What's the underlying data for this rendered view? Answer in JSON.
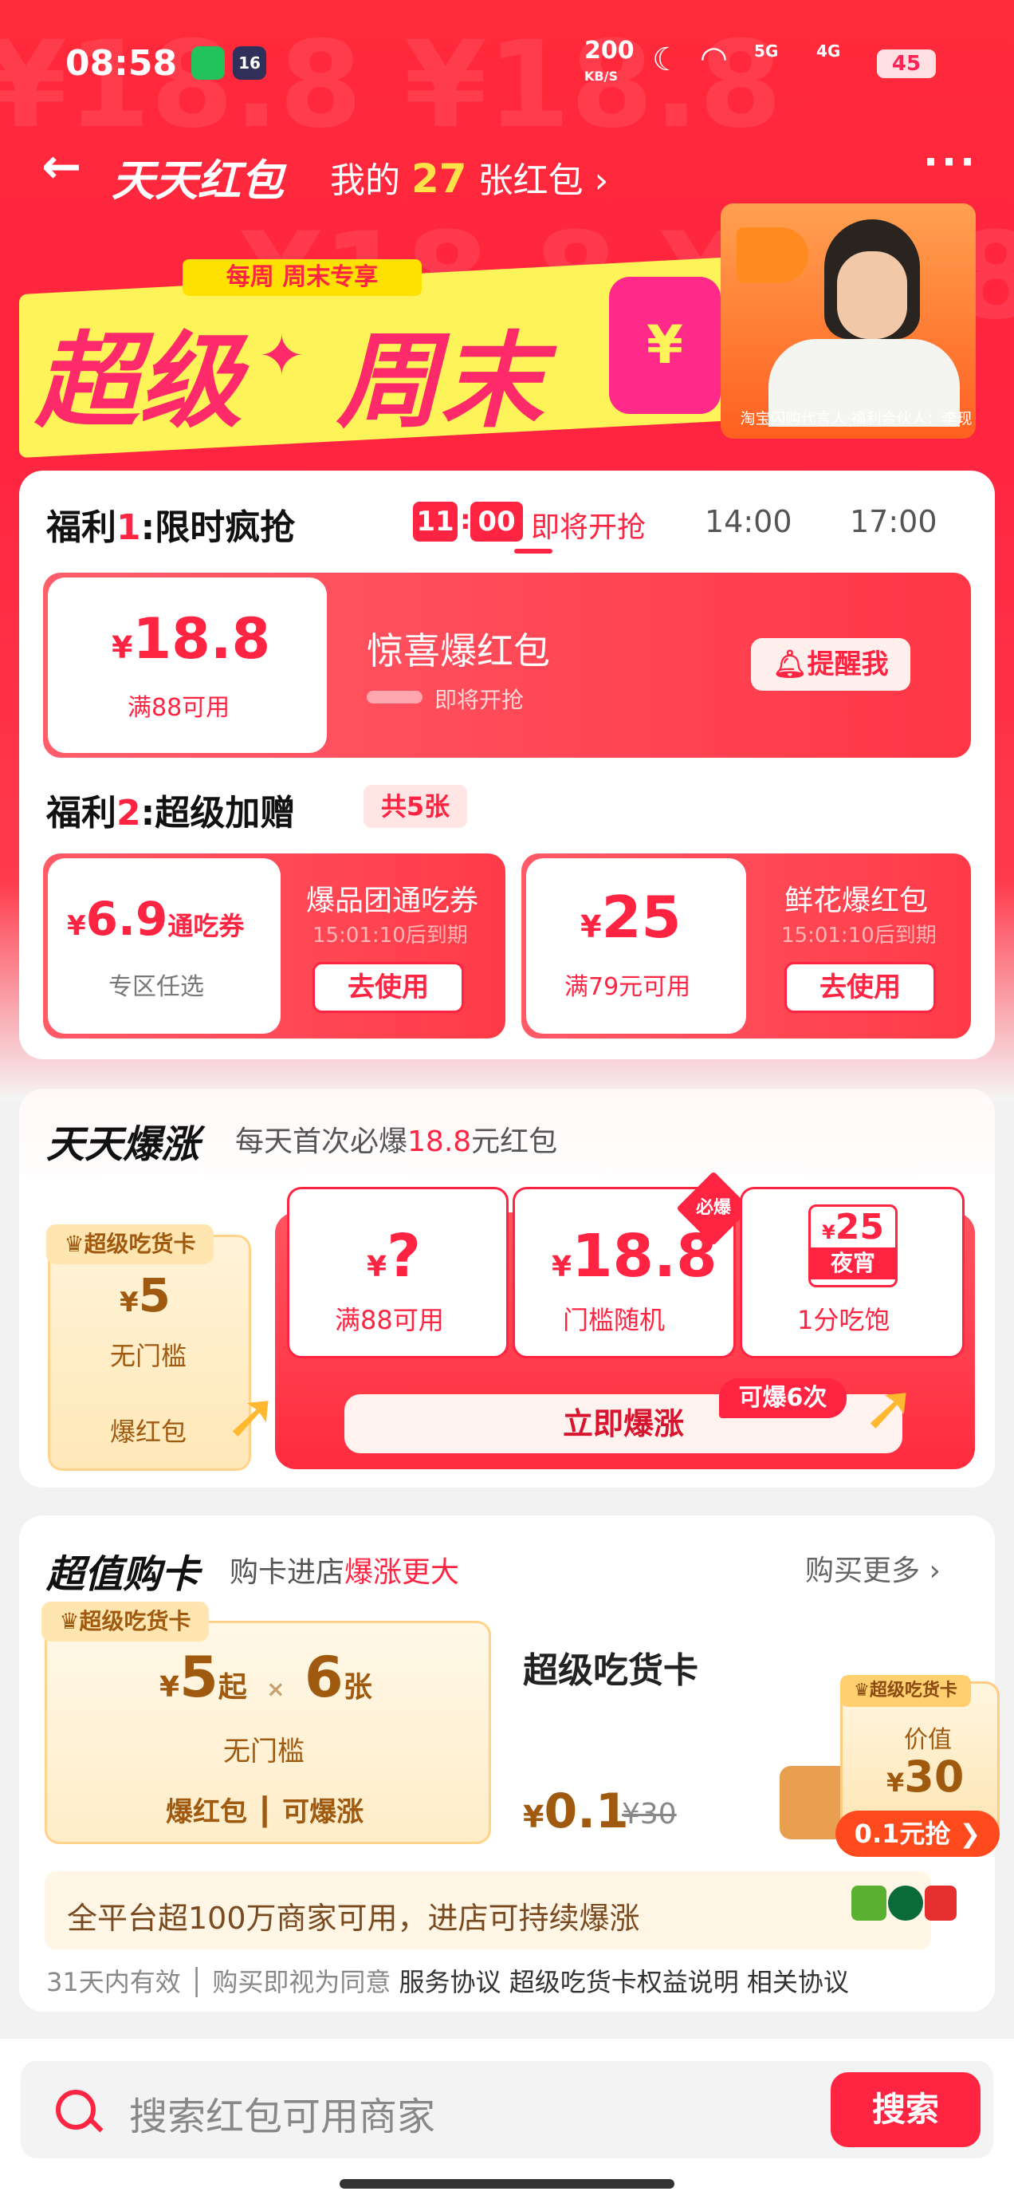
{
  "status": {
    "time": "08:58",
    "app_badge": "16",
    "speed": "200",
    "speed_unit": "KB/S",
    "net1": "5G",
    "net2": "4G",
    "battery": "45"
  },
  "nav": {
    "title": "天天红包",
    "my_prefix": "我的",
    "my_count": "27",
    "my_suffix": "张红包"
  },
  "banner": {
    "tag": "每周 周末专享",
    "title1": "超级",
    "title2": "周末",
    "yen": "¥",
    "caption": "淘宝闪购代言人·福利合伙人：李现"
  },
  "benefit1": {
    "label_a": "福利",
    "num": "1",
    "label_b": ":限时疯抢",
    "slot_h": "11",
    "slot_m": "00",
    "slot_status": "即将开抢",
    "times": [
      "14:00",
      "17:00"
    ],
    "coupon": {
      "amount_sym": "¥",
      "amount": "18.8",
      "cond": "满88可用",
      "name": "惊喜爆红包",
      "status": "即将开抢",
      "btn": "提醒我"
    }
  },
  "benefit2": {
    "label_a": "福利",
    "num": "2",
    "label_b": ":超级加赠",
    "count": "共5张",
    "coupons": [
      {
        "sym": "¥",
        "amount": "6.9",
        "unit": "通吃券",
        "cond": "专区任选",
        "name": "爆品团通吃券",
        "expire": "15:01:10后到期",
        "btn": "去使用"
      },
      {
        "sym": "¥",
        "amount": "25",
        "unit": "",
        "cond": "满79元可用",
        "name": "鲜花爆红包",
        "expire": "15:01:10后到期",
        "btn": "去使用"
      }
    ]
  },
  "daily": {
    "title": "天天爆涨",
    "subtitle_a": "每天首次必爆",
    "subtitle_amt": "18.8",
    "subtitle_b": "元红包",
    "side": {
      "tag": "超级吃货卡",
      "sym": "¥",
      "amount": "5",
      "cond": "无门槛",
      "name": "爆红包"
    },
    "items": [
      {
        "sym": "¥",
        "amount": "?",
        "cond": "满88可用"
      },
      {
        "sym": "¥",
        "amount": "18.8",
        "cond": "门槛随机",
        "badge": "必爆"
      },
      {
        "sym": "¥",
        "amount": "25",
        "tag": "夜宵",
        "cond": "1分吃饱"
      }
    ],
    "btn": "立即爆涨",
    "btn_badge": "可爆6次"
  },
  "card": {
    "title": "超值购卡",
    "subtitle_a": "购卡进店",
    "subtitle_b": "爆涨更大",
    "more": "购买更多",
    "left": {
      "tag": "超级吃货卡",
      "sym": "¥",
      "amount": "5",
      "start": "起",
      "times": "×",
      "count": "6",
      "count_unit": "张",
      "cond": "无门槛",
      "f1": "爆红包",
      "f2": "可爆涨"
    },
    "name": "超级吃货卡",
    "price_sym": "¥",
    "price": "0.1",
    "orig": "¥30",
    "float": {
      "tag": "超级吃货卡",
      "label": "价值",
      "sym": "¥",
      "amount": "30",
      "btn": "0.1元抢"
    },
    "notice": "全平台超100万商家可用，进店可持续爆涨",
    "terms": [
      {
        "t": "31天内有效"
      },
      {
        "t": "购买即视为同意"
      },
      {
        "t": "服务协议"
      },
      {
        "t": "超级吃货卡权益说明"
      },
      {
        "t": "相关协议"
      }
    ]
  },
  "search": {
    "placeholder": "搜索红包可用商家",
    "btn": "搜索"
  },
  "colors": {
    "brand": "#ff2442",
    "gold": "#c8841a",
    "yellow": "#fff35a"
  }
}
